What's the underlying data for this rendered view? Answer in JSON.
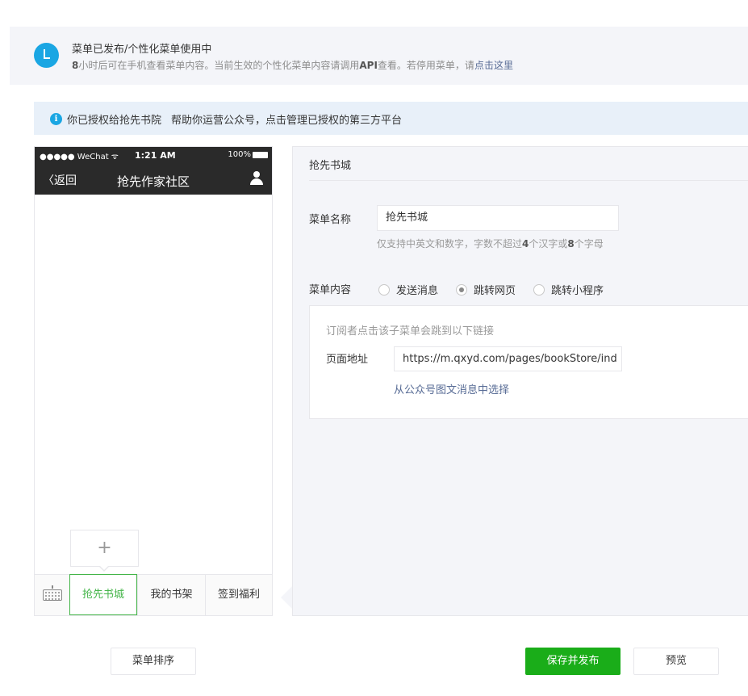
{
  "status": {
    "title": "菜单已发布/个性化菜单使用中",
    "desc_hours": "8",
    "desc_text": "小时后可在手机查看菜单内容。当前生效的个性化菜单内容请调用",
    "desc_api": "API",
    "desc_text2": "查看。若停用菜单，请",
    "desc_link": "点击这里"
  },
  "auth_bar": {
    "info_icon": "i",
    "text1": "你已授权给抢先书院",
    "text2": "帮助你运营公众号，点击管理已授权的第三方平台"
  },
  "phone": {
    "signal": "●●●●● WeChat ᯤ",
    "time": "1:21 AM",
    "battery": "100%",
    "back": "〈返回",
    "title": "抢先作家社区",
    "add_sub_symbol": "+",
    "menu_items": [
      "抢先书城",
      "我的书架",
      "签到福利"
    ]
  },
  "editor": {
    "title": "抢先书城",
    "name_label": "菜单名称",
    "name_value": "抢先书城",
    "hint_pre": "仅支持中英文和数字，字数不超过",
    "hint_n1": "4",
    "hint_mid": "个汉字或",
    "hint_n2": "8",
    "hint_post": "个字母",
    "content_label": "菜单内容",
    "options": [
      "发送消息",
      "跳转网页",
      "跳转小程序"
    ],
    "selected_option": "跳转网页",
    "jump_desc": "订阅者点击该子菜单会跳到以下链接",
    "url_label": "页面地址",
    "url_value": "https://m.qxyd.com/pages/bookStore/ind",
    "pick_link": "从公众号图文消息中选择"
  },
  "footer": {
    "sort_label": "菜单排序",
    "publish_label": "保存并发布",
    "preview_label": "预览"
  },
  "colors": {
    "accent_green": "#1aad19",
    "active_green": "#44b549",
    "info_blue": "#1aa6e3",
    "link_blue": "#576b95"
  }
}
